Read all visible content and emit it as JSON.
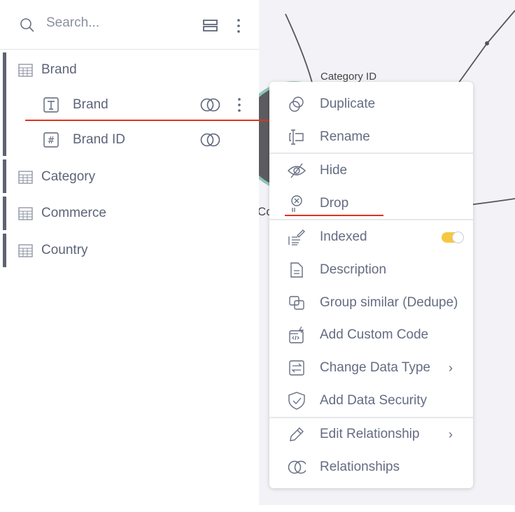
{
  "search": {
    "placeholder": "Search..."
  },
  "tree": [
    {
      "label": "Brand",
      "type": "table",
      "children": [
        {
          "label": "Brand",
          "type": "text"
        },
        {
          "label": "Brand ID",
          "type": "number"
        }
      ]
    },
    {
      "label": "Category",
      "type": "table"
    },
    {
      "label": "Commerce",
      "type": "table"
    },
    {
      "label": "Country",
      "type": "table"
    }
  ],
  "canvas": {
    "edge_label": "Category ID",
    "node_label_partial": "Co"
  },
  "menu": {
    "items": [
      {
        "label": "Duplicate",
        "icon": "duplicate-icon"
      },
      {
        "label": "Rename",
        "icon": "rename-icon"
      },
      {
        "label": "Hide",
        "icon": "eye-off-icon"
      },
      {
        "label": "Drop",
        "icon": "drop-icon"
      },
      {
        "label": "Indexed",
        "icon": "index-icon",
        "toggle": true
      },
      {
        "label": "Description",
        "icon": "document-icon"
      },
      {
        "label": "Group similar (Dedupe)",
        "icon": "group-icon"
      },
      {
        "label": "Add Custom Code",
        "icon": "code-icon"
      },
      {
        "label": "Change Data Type",
        "icon": "swap-icon",
        "submenu": true
      },
      {
        "label": "Add Data Security",
        "icon": "shield-icon"
      },
      {
        "label": "Edit Relationship",
        "icon": "pencil-icon",
        "submenu": true
      },
      {
        "label": "Relationships",
        "icon": "relationships-icon"
      }
    ],
    "chevron": "›"
  },
  "colors": {
    "accent_toggle": "#f5c842",
    "annotation": "#e0321f",
    "group_bar": "#5f6270",
    "text": "#5d6479"
  }
}
